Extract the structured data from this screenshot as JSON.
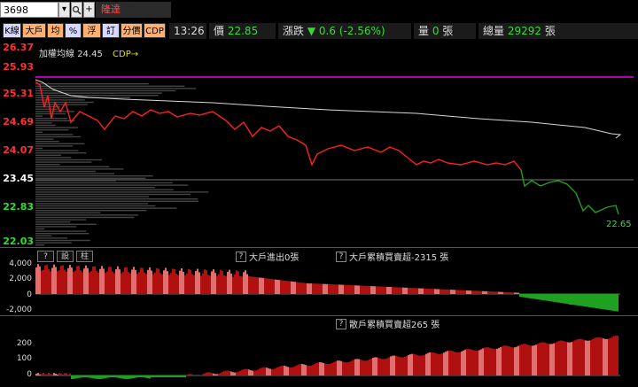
{
  "toolbar": {
    "symbol": "3698",
    "stock_name": "隆達"
  },
  "mode_buttons": [
    "K線",
    "大戶",
    "均",
    "%",
    "浮",
    "訂",
    "分價",
    "CDP"
  ],
  "stats": {
    "time": "13:26",
    "price_label": "價",
    "price": "22.85",
    "change_label": "漲跌",
    "change": "▼ 0.6 (-2.56%)",
    "volume_label": "量",
    "volume": "0",
    "volume_unit": "張",
    "total_label": "總量",
    "total": "29292",
    "total_unit": "張"
  },
  "main_chart": {
    "avg_label": "加權均線",
    "avg_value": "24.45",
    "cdp_label": "CDP→",
    "y_ticks": [
      {
        "v": "26.37",
        "color": "#ff3030"
      },
      {
        "v": "25.93",
        "color": "#ff3030"
      },
      {
        "v": "25.31",
        "color": "#ff3030"
      },
      {
        "v": "24.69",
        "color": "#ff3030"
      },
      {
        "v": "24.07",
        "color": "#ff3030"
      },
      {
        "v": "23.45",
        "color": "#ffffff"
      },
      {
        "v": "22.83",
        "color": "#2ee02e"
      },
      {
        "v": "22.03",
        "color": "#2ee02e"
      }
    ],
    "last_price_label": "22.65",
    "colors": {
      "up": "#ff2020",
      "down": "#20a020",
      "avg": "#d8d8d8",
      "cdp": "#b000b0"
    }
  },
  "panel1": {
    "btn_question": "?",
    "btn_settings": "設",
    "btn_column": "柱",
    "title1": "大戶進出0張",
    "title2": "大戶累積買賣超-2315 張",
    "y_ticks": [
      "4,000",
      "2,000",
      "0",
      "-2,000"
    ]
  },
  "panel2": {
    "title": "散戶累積買賣超265 張",
    "y_ticks": [
      "200",
      "100",
      "0"
    ]
  }
}
